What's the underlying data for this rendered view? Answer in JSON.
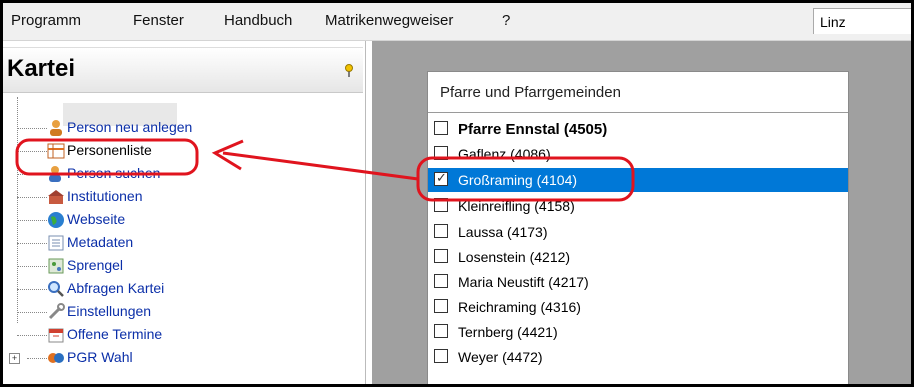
{
  "menu": {
    "items": [
      "Programm",
      "Fenster",
      "Handbuch",
      "Matrikenwegweiser",
      "?"
    ],
    "location_value": "Linz"
  },
  "left_panel": {
    "title": "Kartei",
    "tree_items": [
      {
        "label": "Person neu anlegen",
        "icon": "person-add-icon"
      },
      {
        "label": "Personenliste",
        "icon": "person-list-icon"
      },
      {
        "label": "Person suchen",
        "icon": "person-search-icon"
      },
      {
        "label": "Institutionen",
        "icon": "institution-icon"
      },
      {
        "label": "Webseite",
        "icon": "globe-icon"
      },
      {
        "label": "Metadaten",
        "icon": "metadata-icon"
      },
      {
        "label": "Sprengel",
        "icon": "map-icon"
      },
      {
        "label": "Abfragen Kartei",
        "icon": "magnifier-icon"
      },
      {
        "label": "Einstellungen",
        "icon": "wrench-icon"
      },
      {
        "label": "Offene Termine",
        "icon": "calendar-icon"
      },
      {
        "label": "PGR Wahl",
        "icon": "vote-icon"
      }
    ]
  },
  "dialog": {
    "title": "Pfarre und Pfarrgemeinden",
    "items": [
      {
        "label": "Pfarre Ennstal (4505)",
        "checked": false
      },
      {
        "label": "Gaflenz (4086)",
        "checked": false
      },
      {
        "label": "Großraming (4104)",
        "checked": true
      },
      {
        "label": "Kleinreifling (4158)",
        "checked": false
      },
      {
        "label": "Laussa (4173)",
        "checked": false
      },
      {
        "label": "Losenstein (4212)",
        "checked": false
      },
      {
        "label": "Maria Neustift (4217)",
        "checked": false
      },
      {
        "label": "Reichraming (4316)",
        "checked": false
      },
      {
        "label": "Ternberg (4421)",
        "checked": false
      },
      {
        "label": "Weyer (4472)",
        "checked": false
      }
    ]
  },
  "colors": {
    "highlight": "#0078d7",
    "annotation": "#e0141e",
    "link": "#0b2fa8"
  }
}
